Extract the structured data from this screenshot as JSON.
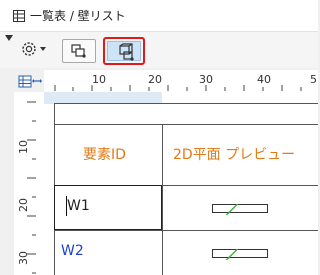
{
  "window": {
    "title": "一覧表 / 壁リスト",
    "title_icon": "table-icon"
  },
  "toolbar": {
    "collapse_icon": "triangle-down-icon",
    "settings_icon": "gear-dropdown-icon",
    "button1_icon": "plan-view-icon",
    "button2_icon": "3d-view-icon",
    "button2_selected": true,
    "highlight_color": "#e01a1a"
  },
  "rulers": {
    "corner_icon": "ruler-settings-icon",
    "top_labels": [
      "10",
      "20",
      "30",
      "40",
      "5"
    ],
    "left_labels": [
      "10",
      "20",
      "30"
    ]
  },
  "table": {
    "columns": [
      "要素ID",
      "2D平面 プレビュー"
    ],
    "header_color": "#e07a16",
    "rows": [
      {
        "id": "W1",
        "color": "#222222",
        "selected": true
      },
      {
        "id": "W2",
        "color": "#1e3fd4",
        "selected": false
      }
    ]
  }
}
